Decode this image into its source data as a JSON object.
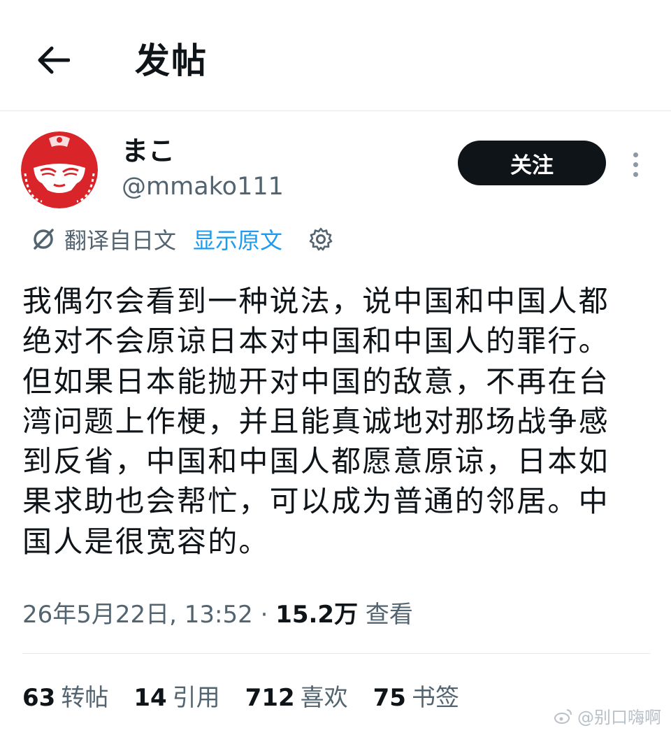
{
  "header": {
    "title": "发帖",
    "back_icon": "arrow-left-icon"
  },
  "author": {
    "display_name": "まこ",
    "handle": "@mmako111",
    "follow_label": "关注",
    "avatar_colors": [
      "#d9252a",
      "#ffffff"
    ]
  },
  "translation": {
    "label": "翻译自日文",
    "show_original_label": "显示原文",
    "link_color": "#1d9bf0"
  },
  "tweet": {
    "text": "我偶尔会看到一种说法，说中国和中国人都绝对不会原谅日本对中国和中国人的罪行。但如果日本能抛开对中国的敌意，不再在台湾问题上作梗，并且能真诚地对那场战争感到反省，中国和中国人都愿意原谅，日本如果求助也会帮忙，可以成为普通的邻居。中国人是很宽容的。"
  },
  "meta": {
    "timestamp": "26年5月22日, 13:52",
    "separator": "·",
    "views_count": "15.2万",
    "views_label": "查看"
  },
  "stats": [
    {
      "count": "63",
      "label": "转帖"
    },
    {
      "count": "14",
      "label": "引用"
    },
    {
      "count": "712",
      "label": "喜欢"
    },
    {
      "count": "75",
      "label": "书签"
    }
  ],
  "watermark": {
    "text": "@别口嗨啊"
  }
}
